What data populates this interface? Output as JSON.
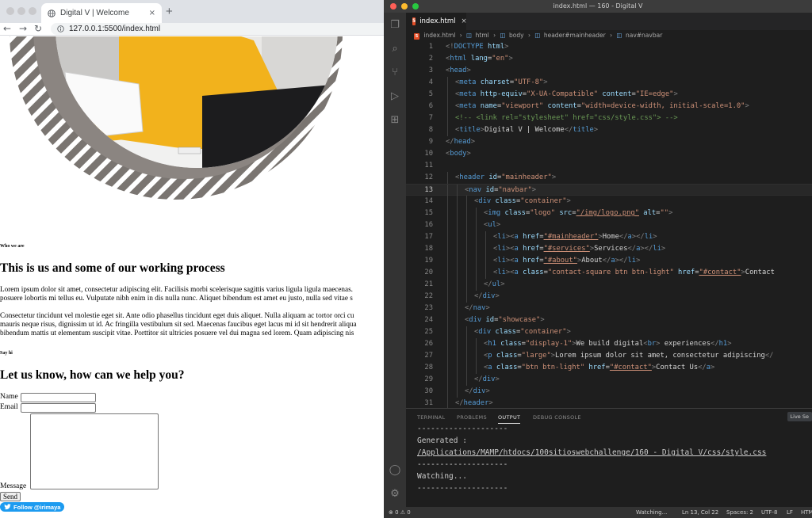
{
  "browser": {
    "tab_title": "Digital V | Welcome",
    "tab_close": "×",
    "new_tab": "+",
    "url": "127.0.0.1:5500/index.html"
  },
  "page": {
    "who_we_are": "Who we are",
    "about_title": "This is us and some of our working process",
    "paragraphs": [
      "Lorem ipsum dolor sit amet, consectetur adipiscing elit. Facilisis morbi scelerisque sagittis varius ligula ligula maecenas.",
      "posuere lobortis mi tellus eu. Vulputate nibh enim in dis nulla nunc. Aliquet bibendum est amet eu justo, nulla sed vitae s",
      "Consectetur tincidunt vel molestie eget sit. Ante odio phasellus tincidunt eget duis aliquet. Nulla aliquam ac tortor orci cu",
      "mauris neque risus, dignissim ut id. Ac fringilla vestibulum sit sed. Maecenas faucibus eget lacus mi id sit hendrerit aliqua",
      "bibendum mattis ut elementum suscipit vitae. Porttitor sit ultricies posuere vel dui magna sed lorem. Quam adipiscing nis"
    ],
    "say_hi": "Say hi",
    "contact_title": "Let us know, how can we help you?",
    "name_label": "Name",
    "email_label": "Email",
    "message_label": "Message",
    "send_label": "Send",
    "follow_label": "Follow @irimaya"
  },
  "vscode": {
    "window_title": "index.html — 160 - Digital V",
    "tab_label": "index.html",
    "tab_close": "×",
    "breadcrumb": [
      "index.html",
      "html",
      "body",
      "header#mainheader",
      "nav#navbar"
    ],
    "current_line": 13,
    "panel_tabs": [
      "TERMINAL",
      "PROBLEMS",
      "OUTPUT",
      "DEBUG CONSOLE"
    ],
    "active_panel_tab": "OUTPUT",
    "live_server": "Live Se",
    "output": [
      "--------------------",
      "Generated :",
      "/Applications/MAMP/htdocs/100sitioswebchallenge/160 - Digital V/css/style.css",
      "--------------------",
      "Watching...",
      "--------------------"
    ],
    "status": {
      "errors": "⊗ 0 ⚠ 0",
      "watching": "Watching...",
      "position": "Ln 13, Col 22",
      "spaces": "Spaces: 2",
      "encoding": "UTF-8",
      "eol": "LF",
      "language": "HTM"
    },
    "code_lines": [
      {
        "n": "1",
        "i": 0,
        "seg": [
          [
            "ang",
            "<!"
          ],
          [
            "t",
            "DOCTYPE"
          ],
          [
            "a",
            " html"
          ],
          [
            "ang",
            ">"
          ]
        ]
      },
      {
        "n": "2",
        "i": 0,
        "seg": [
          [
            "ang",
            "<"
          ],
          [
            "t",
            "html"
          ],
          [
            "a",
            " lang"
          ],
          [
            "tx",
            "="
          ],
          [
            "s",
            "\"en\""
          ],
          [
            "ang",
            ">"
          ]
        ]
      },
      {
        "n": "3",
        "i": 0,
        "seg": [
          [
            "ang",
            "<"
          ],
          [
            "t",
            "head"
          ],
          [
            "ang",
            ">"
          ]
        ]
      },
      {
        "n": "4",
        "i": 1,
        "seg": [
          [
            "ang",
            "<"
          ],
          [
            "t",
            "meta"
          ],
          [
            "a",
            " charset"
          ],
          [
            "tx",
            "="
          ],
          [
            "s",
            "\"UTF-8\""
          ],
          [
            "ang",
            ">"
          ]
        ]
      },
      {
        "n": "5",
        "i": 1,
        "seg": [
          [
            "ang",
            "<"
          ],
          [
            "t",
            "meta"
          ],
          [
            "a",
            " http-equiv"
          ],
          [
            "tx",
            "="
          ],
          [
            "s",
            "\"X-UA-Compatible\""
          ],
          [
            "a",
            " content"
          ],
          [
            "tx",
            "="
          ],
          [
            "s",
            "\"IE=edge\""
          ],
          [
            "ang",
            ">"
          ]
        ]
      },
      {
        "n": "6",
        "i": 1,
        "seg": [
          [
            "ang",
            "<"
          ],
          [
            "t",
            "meta"
          ],
          [
            "a",
            " name"
          ],
          [
            "tx",
            "="
          ],
          [
            "s",
            "\"viewport\""
          ],
          [
            "a",
            " content"
          ],
          [
            "tx",
            "="
          ],
          [
            "s",
            "\"width=device-width, initial-scale=1.0\""
          ],
          [
            "ang",
            ">"
          ]
        ]
      },
      {
        "n": "7",
        "i": 1,
        "seg": [
          [
            "c",
            "<!-- <link rel=\"stylesheet\" href=\"css/style.css\"> -->"
          ]
        ]
      },
      {
        "n": "8",
        "i": 1,
        "seg": [
          [
            "ang",
            "<"
          ],
          [
            "t",
            "title"
          ],
          [
            "ang",
            ">"
          ],
          [
            "tx",
            "Digital V | Welcome"
          ],
          [
            "ang",
            "</"
          ],
          [
            "t",
            "title"
          ],
          [
            "ang",
            ">"
          ]
        ]
      },
      {
        "n": "9",
        "i": 0,
        "seg": [
          [
            "ang",
            "</"
          ],
          [
            "t",
            "head"
          ],
          [
            "ang",
            ">"
          ]
        ]
      },
      {
        "n": "10",
        "i": 0,
        "seg": [
          [
            "ang",
            "<"
          ],
          [
            "t",
            "body"
          ],
          [
            "ang",
            ">"
          ]
        ]
      },
      {
        "n": "11",
        "i": 0,
        "seg": []
      },
      {
        "n": "12",
        "i": 1,
        "seg": [
          [
            "ang",
            "<"
          ],
          [
            "t",
            "header"
          ],
          [
            "a",
            " id"
          ],
          [
            "tx",
            "="
          ],
          [
            "s",
            "\"mainheader\""
          ],
          [
            "ang",
            ">"
          ]
        ]
      },
      {
        "n": "13",
        "i": 2,
        "seg": [
          [
            "ang",
            "<"
          ],
          [
            "t",
            "nav"
          ],
          [
            "a",
            " id"
          ],
          [
            "tx",
            "="
          ],
          [
            "s",
            "\"navbar\""
          ],
          [
            "ang",
            ">"
          ]
        ]
      },
      {
        "n": "14",
        "i": 3,
        "seg": [
          [
            "ang",
            "<"
          ],
          [
            "t",
            "div"
          ],
          [
            "a",
            " class"
          ],
          [
            "tx",
            "="
          ],
          [
            "s",
            "\"container\""
          ],
          [
            "ang",
            ">"
          ]
        ]
      },
      {
        "n": "15",
        "i": 4,
        "seg": [
          [
            "ang",
            "<"
          ],
          [
            "t",
            "img"
          ],
          [
            "a",
            " class"
          ],
          [
            "tx",
            "="
          ],
          [
            "s",
            "\"logo\""
          ],
          [
            "a",
            " src"
          ],
          [
            "tx",
            "="
          ],
          [
            "u",
            "\"/img/logo.png\""
          ],
          [
            "a",
            " alt"
          ],
          [
            "tx",
            "="
          ],
          [
            "s",
            "\"\""
          ],
          [
            "ang",
            ">"
          ]
        ]
      },
      {
        "n": "16",
        "i": 4,
        "seg": [
          [
            "ang",
            "<"
          ],
          [
            "t",
            "ul"
          ],
          [
            "ang",
            ">"
          ]
        ]
      },
      {
        "n": "17",
        "i": 5,
        "seg": [
          [
            "ang",
            "<"
          ],
          [
            "t",
            "li"
          ],
          [
            "ang",
            "><"
          ],
          [
            "t",
            "a"
          ],
          [
            "a",
            " href"
          ],
          [
            "tx",
            "="
          ],
          [
            "u",
            "\"#mainheader\""
          ],
          [
            "ang",
            ">"
          ],
          [
            "tx",
            "Home"
          ],
          [
            "ang",
            "</"
          ],
          [
            "t",
            "a"
          ],
          [
            "ang",
            "></"
          ],
          [
            "t",
            "li"
          ],
          [
            "ang",
            ">"
          ]
        ]
      },
      {
        "n": "18",
        "i": 5,
        "seg": [
          [
            "ang",
            "<"
          ],
          [
            "t",
            "li"
          ],
          [
            "ang",
            "><"
          ],
          [
            "t",
            "a"
          ],
          [
            "a",
            " href"
          ],
          [
            "tx",
            "="
          ],
          [
            "u",
            "\"#services\""
          ],
          [
            "ang",
            ">"
          ],
          [
            "tx",
            "Services"
          ],
          [
            "ang",
            "</"
          ],
          [
            "t",
            "a"
          ],
          [
            "ang",
            "></"
          ],
          [
            "t",
            "li"
          ],
          [
            "ang",
            ">"
          ]
        ]
      },
      {
        "n": "19",
        "i": 5,
        "seg": [
          [
            "ang",
            "<"
          ],
          [
            "t",
            "li"
          ],
          [
            "ang",
            "><"
          ],
          [
            "t",
            "a"
          ],
          [
            "a",
            " href"
          ],
          [
            "tx",
            "="
          ],
          [
            "u",
            "\"#about\""
          ],
          [
            "ang",
            ">"
          ],
          [
            "tx",
            "About"
          ],
          [
            "ang",
            "</"
          ],
          [
            "t",
            "a"
          ],
          [
            "ang",
            "></"
          ],
          [
            "t",
            "li"
          ],
          [
            "ang",
            ">"
          ]
        ]
      },
      {
        "n": "20",
        "i": 5,
        "seg": [
          [
            "ang",
            "<"
          ],
          [
            "t",
            "li"
          ],
          [
            "ang",
            "><"
          ],
          [
            "t",
            "a"
          ],
          [
            "a",
            " class"
          ],
          [
            "tx",
            "="
          ],
          [
            "s",
            "\"contact-square btn btn-light\""
          ],
          [
            "a",
            " href"
          ],
          [
            "tx",
            "="
          ],
          [
            "u",
            "\"#contact\""
          ],
          [
            "ang",
            ">"
          ],
          [
            "tx",
            "Contact"
          ]
        ]
      },
      {
        "n": "21",
        "i": 4,
        "seg": [
          [
            "ang",
            "</"
          ],
          [
            "t",
            "ul"
          ],
          [
            "ang",
            ">"
          ]
        ]
      },
      {
        "n": "22",
        "i": 3,
        "seg": [
          [
            "ang",
            "</"
          ],
          [
            "t",
            "div"
          ],
          [
            "ang",
            ">"
          ]
        ]
      },
      {
        "n": "23",
        "i": 2,
        "seg": [
          [
            "ang",
            "</"
          ],
          [
            "t",
            "nav"
          ],
          [
            "ang",
            ">"
          ]
        ]
      },
      {
        "n": "24",
        "i": 2,
        "seg": [
          [
            "ang",
            "<"
          ],
          [
            "t",
            "div"
          ],
          [
            "a",
            " id"
          ],
          [
            "tx",
            "="
          ],
          [
            "s",
            "\"showcase\""
          ],
          [
            "ang",
            ">"
          ]
        ]
      },
      {
        "n": "25",
        "i": 3,
        "seg": [
          [
            "ang",
            "<"
          ],
          [
            "t",
            "div"
          ],
          [
            "a",
            " class"
          ],
          [
            "tx",
            "="
          ],
          [
            "s",
            "\"container\""
          ],
          [
            "ang",
            ">"
          ]
        ]
      },
      {
        "n": "26",
        "i": 4,
        "seg": [
          [
            "ang",
            "<"
          ],
          [
            "t",
            "h1"
          ],
          [
            "a",
            " class"
          ],
          [
            "tx",
            "="
          ],
          [
            "s",
            "\"display-1\""
          ],
          [
            "ang",
            ">"
          ],
          [
            "tx",
            "We build digital"
          ],
          [
            "ang",
            "<"
          ],
          [
            "t",
            "br"
          ],
          [
            "ang",
            "> "
          ],
          [
            "tx",
            "experiences"
          ],
          [
            "ang",
            "</"
          ],
          [
            "t",
            "h1"
          ],
          [
            "ang",
            ">"
          ]
        ]
      },
      {
        "n": "27",
        "i": 4,
        "seg": [
          [
            "ang",
            "<"
          ],
          [
            "t",
            "p"
          ],
          [
            "a",
            " class"
          ],
          [
            "tx",
            "="
          ],
          [
            "s",
            "\"large\""
          ],
          [
            "ang",
            ">"
          ],
          [
            "tx",
            "Lorem ipsum dolor sit amet, consectetur adipiscing"
          ],
          [
            "ang",
            "</"
          ]
        ]
      },
      {
        "n": "28",
        "i": 4,
        "seg": [
          [
            "ang",
            "<"
          ],
          [
            "t",
            "a"
          ],
          [
            "a",
            " class"
          ],
          [
            "tx",
            "="
          ],
          [
            "s",
            "\"btn btn-light\""
          ],
          [
            "a",
            " href"
          ],
          [
            "tx",
            "="
          ],
          [
            "u",
            "\"#contact\""
          ],
          [
            "ang",
            ">"
          ],
          [
            "tx",
            "Contact Us"
          ],
          [
            "ang",
            "</"
          ],
          [
            "t",
            "a"
          ],
          [
            "ang",
            ">"
          ]
        ]
      },
      {
        "n": "29",
        "i": 3,
        "seg": [
          [
            "ang",
            "</"
          ],
          [
            "t",
            "div"
          ],
          [
            "ang",
            ">"
          ]
        ]
      },
      {
        "n": "30",
        "i": 2,
        "seg": [
          [
            "ang",
            "</"
          ],
          [
            "t",
            "div"
          ],
          [
            "ang",
            ">"
          ]
        ]
      },
      {
        "n": "31",
        "i": 1,
        "seg": [
          [
            "ang",
            "</"
          ],
          [
            "t",
            "header"
          ],
          [
            "ang",
            ">"
          ]
        ]
      }
    ]
  }
}
